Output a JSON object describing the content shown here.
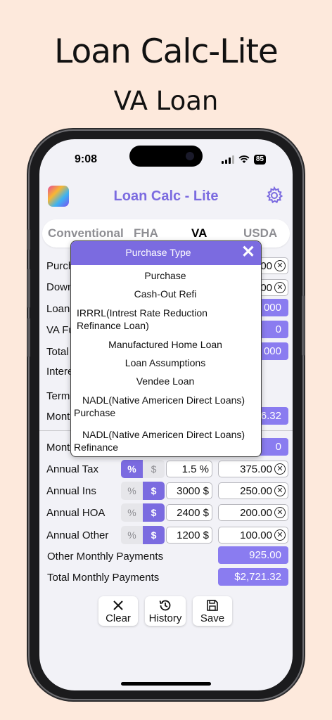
{
  "hero": {
    "title": "Loan Calc-Lite",
    "subtitle": "VA Loan"
  },
  "status": {
    "time": "9:08",
    "battery": "85"
  },
  "app": {
    "title": "Loan Calc - Lite",
    "accent": "#7b6be0"
  },
  "tabs": [
    {
      "label": "Conventional",
      "active": false
    },
    {
      "label": "FHA",
      "active": false
    },
    {
      "label": "VA",
      "active": true
    },
    {
      "label": "USDA",
      "active": false
    }
  ],
  "form_behind": {
    "labels": [
      "Purch",
      "Down",
      "Loan",
      "VA Fu",
      "Total",
      "Intere",
      "Term",
      "Mont",
      "Mont"
    ],
    "values": [
      "00",
      "00",
      "000",
      "0",
      "000",
      "6.32",
      "0"
    ]
  },
  "expenses": [
    {
      "label": "Annual Tax",
      "pct_symbol": "%",
      "usd_symbol": "$",
      "mode": "pct",
      "rate": "1.5 %",
      "amount": "375.00"
    },
    {
      "label": "Annual Ins",
      "pct_symbol": "%",
      "usd_symbol": "$",
      "mode": "usd",
      "rate": "3000 $",
      "amount": "250.00"
    },
    {
      "label": "Annual HOA",
      "pct_symbol": "%",
      "usd_symbol": "$",
      "mode": "usd",
      "rate": "2400 $",
      "amount": "200.00"
    },
    {
      "label": "Annual Other",
      "pct_symbol": "%",
      "usd_symbol": "$",
      "mode": "usd",
      "rate": "1200 $",
      "amount": "100.00"
    }
  ],
  "totals": {
    "other_label": "Other Monthly Payments",
    "other_value": "925.00",
    "total_label": "Total Monthly Payments",
    "total_value": "$2,721.32"
  },
  "toolbar": {
    "clear": "Clear",
    "history": "History",
    "save": "Save"
  },
  "modal": {
    "title": "Purchase Type",
    "options": [
      "Purchase",
      "Cash-Out Refi",
      "IRRRL(Intrest Rate Reduction Refinance Loan)",
      "Manufactured Home Loan",
      "Loan Assumptions",
      "Vendee Loan",
      "NADL(Native Americen Direct Loans) Purchase",
      "NADL(Native Americen Direct Loans) Refinance"
    ]
  }
}
